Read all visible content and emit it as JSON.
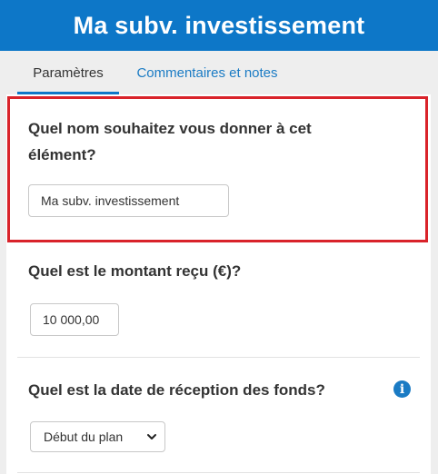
{
  "header": {
    "title": "Ma subv. investissement"
  },
  "tabs": [
    {
      "label": "Paramètres",
      "active": true
    },
    {
      "label": "Commentaires et notes",
      "active": false
    }
  ],
  "form": {
    "name": {
      "question": "Quel nom souhaitez vous donner à cet élément?",
      "value": "Ma subv. investissement"
    },
    "amount": {
      "question": "Quel est le montant reçu (€)?",
      "value": "10 000,00"
    },
    "date": {
      "question": "Quel est la date de réception des fonds?",
      "selected": "Début du plan",
      "info_icon": "info-icon"
    }
  },
  "colors": {
    "header_bg": "#0d77c8",
    "link": "#1a7bc4",
    "highlight_border": "#d9232a"
  }
}
